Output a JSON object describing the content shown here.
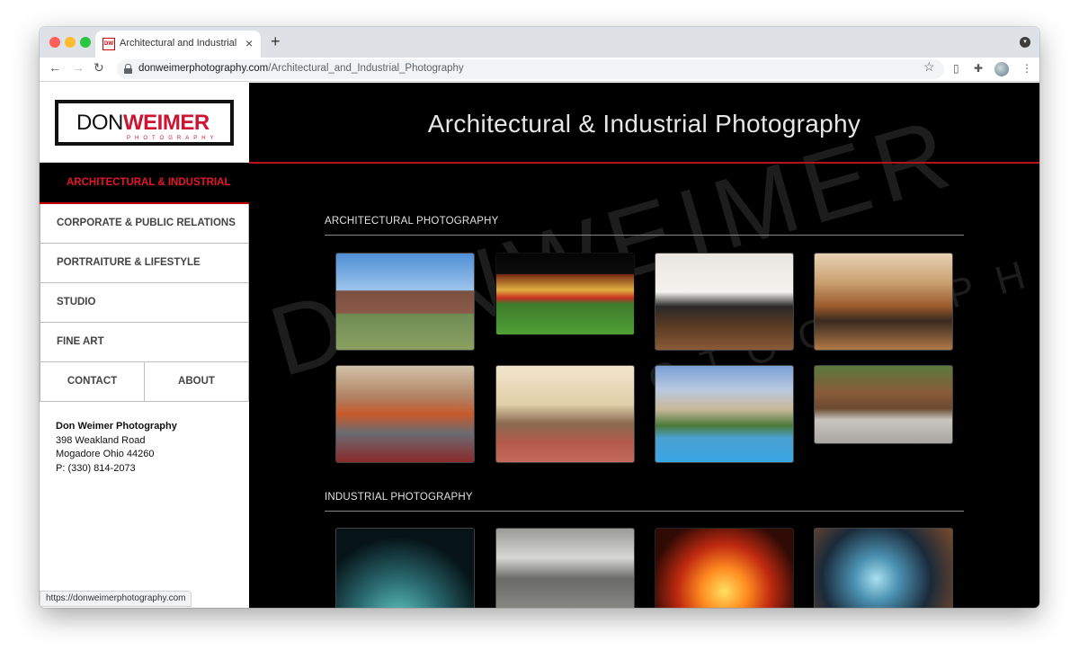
{
  "browser": {
    "tab_title": "Architectural and Industrial Photography",
    "favicon_text": "DW",
    "url_host": "donweimerphotography.com",
    "url_path": "/Architectural_and_Industrial_Photography",
    "status_url": "https://donweimerphotography.com"
  },
  "logo": {
    "don": "DON",
    "weimer": "WEIMER",
    "sub": "PHOTOGRAPHY"
  },
  "nav": {
    "active": "ARCHITECTURAL & INDUSTRIAL",
    "items": [
      "CORPORATE & PUBLIC RELATIONS",
      "PORTRAITURE & LIFESTYLE",
      "STUDIO",
      "FINE ART"
    ],
    "contact": "CONTACT",
    "about": "ABOUT"
  },
  "address": {
    "name": "Don Weimer Photography",
    "street": "398 Weakland Road",
    "city": "Mogadore Ohio 44260",
    "phone": "P: (330) 814-2073"
  },
  "main": {
    "title": "Architectural & Industrial Photography",
    "watermark": "DONWEIMER",
    "watermark_sub": "PHOTOGRAPHY",
    "section1": "ARCHITECTURAL PHOTOGRAPHY",
    "section2": "INDUSTRIAL PHOTOGRAPHY"
  },
  "colors": {
    "accent_red": "#e8152a",
    "brand_red": "#cc1433",
    "page_bg": "#000000"
  }
}
